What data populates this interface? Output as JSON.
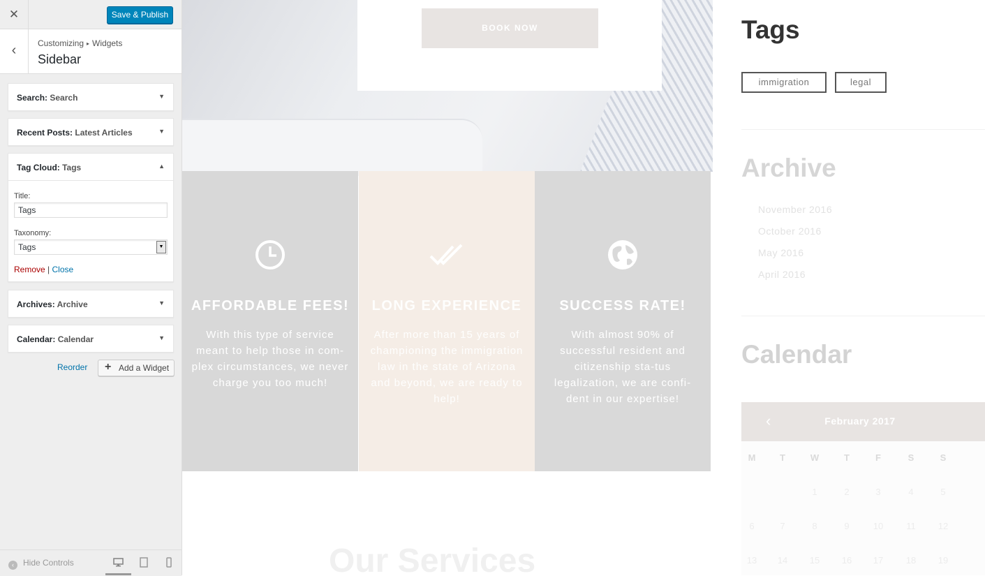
{
  "customizer": {
    "close_icon": "✕",
    "publish_label": "Save & Publish",
    "breadcrumb": {
      "first": "Customizing",
      "sep": "▸",
      "second": "Widgets"
    },
    "section_title": "Sidebar",
    "back_icon": "‹",
    "widgets": [
      {
        "type": "Search:",
        "title": "Search",
        "arrow": "▼"
      },
      {
        "type": "Recent Posts:",
        "title": "Latest Articles",
        "arrow": "▼"
      },
      {
        "type": "Tag Cloud:",
        "title": "Tags",
        "arrow": "▲"
      },
      {
        "type": "Archives:",
        "title": "Archive",
        "arrow": "▼"
      },
      {
        "type": "Calendar:",
        "title": "Calendar",
        "arrow": "▼"
      }
    ],
    "tag_cloud_form": {
      "title_label": "Title:",
      "title_value": "Tags",
      "taxonomy_label": "Taxonomy:",
      "taxonomy_value": "Tags",
      "remove_label": "Remove",
      "separator": "|",
      "close_label": "Close"
    },
    "reorder_label": "Reorder",
    "add_widget_label": "Add a Widget",
    "add_widget_icon": "+",
    "hide_controls_label": "Hide Controls",
    "devices": [
      "desktop-icon",
      "tablet-icon",
      "mobile-icon"
    ]
  },
  "preview": {
    "book_now": "BOOK NOW",
    "features": [
      {
        "title": "AFFORDABLE FEES!",
        "text": "With this type of service meant to help those in com-plex circumstances, we never charge you too much!",
        "icon": "clock-icon"
      },
      {
        "title": "LONG EXPERIENCE",
        "text": "After more than 15 years of championing the immigration law in the state of Arizona and beyond, we are ready to help!",
        "icon": "double-check-icon"
      },
      {
        "title": "SUCCESS RATE!",
        "text": "With almost 90% of successful resident and citizenship sta-tus legalization, we are confi-dent in our expertise!",
        "icon": "globe-icon"
      }
    ],
    "our_services": "Our Services",
    "sidebar": {
      "tags_title": "Tags",
      "tags": [
        "immigration",
        "legal"
      ],
      "archive_title": "Archive",
      "archive_items": [
        "November 2016",
        "October 2016",
        "May 2016",
        "April 2016"
      ],
      "calendar_title": "Calendar",
      "calendar_prev": "‹",
      "calendar_month": "February 2017",
      "calendar_days": [
        "M",
        "T",
        "W",
        "T",
        "F",
        "S",
        "S"
      ],
      "calendar_rows": [
        [
          "",
          "",
          "1",
          "2",
          "3",
          "4",
          "5"
        ],
        [
          "6",
          "7",
          "8",
          "9",
          "10",
          "11",
          "12"
        ],
        [
          "13",
          "14",
          "15",
          "16",
          "17",
          "18",
          "19"
        ]
      ]
    }
  },
  "colors": {
    "primary_button": "#0085ba",
    "remove_link": "#a00",
    "link": "#0073aa",
    "accent_tan": "#e8e4e2"
  }
}
